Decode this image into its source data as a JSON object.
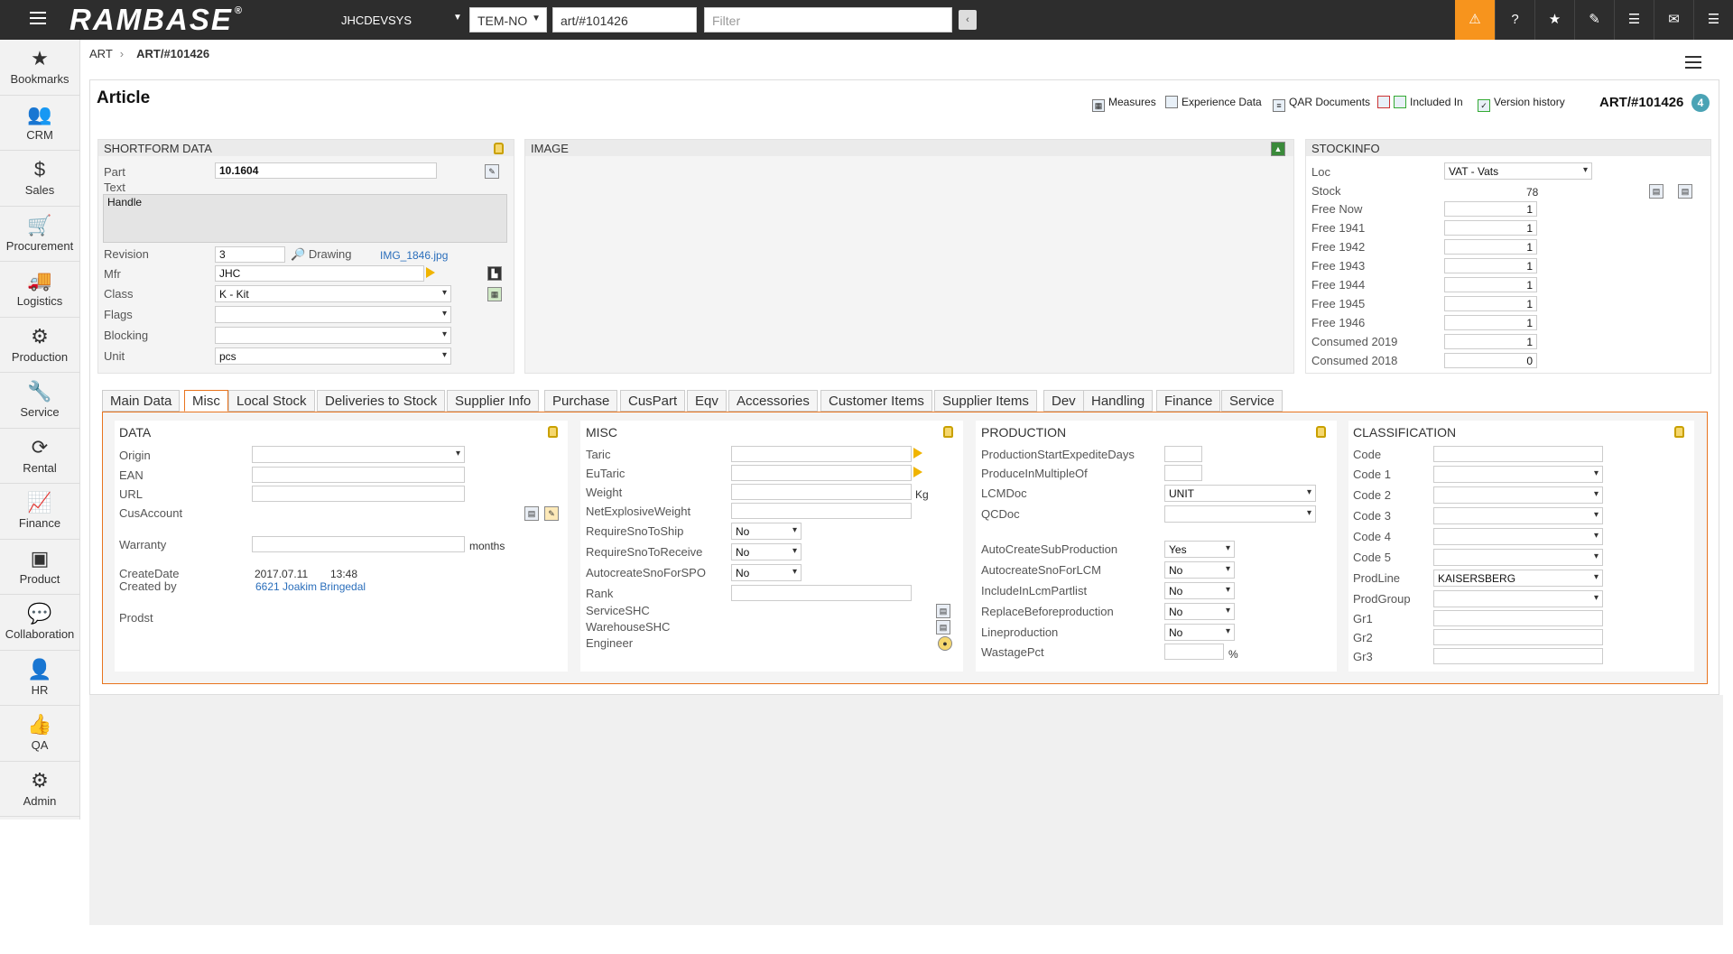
{
  "topbar": {
    "logo": "RAMBASE",
    "logo_mark": "®",
    "system": "JHCDEVSYS",
    "company": "TEM-NO",
    "location": "art/#101426",
    "filter_placeholder": "Filter",
    "collapse": "‹",
    "icons": [
      "warning-icon",
      "help-icon",
      "star-icon",
      "attachment-icon",
      "list-icon",
      "mail-icon",
      "menu-icon"
    ]
  },
  "sidebar": {
    "items": [
      {
        "label": "Bookmarks",
        "icon": "★"
      },
      {
        "label": "CRM",
        "icon": "👥"
      },
      {
        "label": "Sales",
        "icon": "$"
      },
      {
        "label": "Procurement",
        "icon": "🛒"
      },
      {
        "label": "Logistics",
        "icon": "🚚"
      },
      {
        "label": "Production",
        "icon": "⚙"
      },
      {
        "label": "Service",
        "icon": "🔧"
      },
      {
        "label": "Rental",
        "icon": "⟳"
      },
      {
        "label": "Finance",
        "icon": "📈"
      },
      {
        "label": "Product",
        "icon": "▣"
      },
      {
        "label": "Collaboration",
        "icon": "💬"
      },
      {
        "label": "HR",
        "icon": "👤"
      },
      {
        "label": "QA",
        "icon": "👍"
      },
      {
        "label": "Admin",
        "icon": "⚙"
      }
    ]
  },
  "breadcrumb": {
    "root": "ART",
    "sep": "›",
    "current": "ART/#101426"
  },
  "article": {
    "title": "Article",
    "links": {
      "measures": "Measures",
      "experience": "Experience Data",
      "qar": "QAR Documents",
      "included": "Included In",
      "version": "Version history"
    },
    "number": "ART/#101426",
    "badge": "4"
  },
  "shortform": {
    "header": "SHORTFORM DATA",
    "part_label": "Part",
    "part": "10.1604",
    "text_label": "Text",
    "text": "Handle",
    "revision_label": "Revision",
    "revision": "3",
    "drawing_label": "Drawing",
    "drawing": "IMG_1846.jpg",
    "mfr_label": "Mfr",
    "mfr": "JHC",
    "class_label": "Class",
    "class": "K - Kit",
    "flags_label": "Flags",
    "flags": "",
    "blocking_label": "Blocking",
    "blocking": "",
    "unit_label": "Unit",
    "unit": "pcs"
  },
  "image": {
    "header": "IMAGE"
  },
  "stockinfo": {
    "header": "STOCKINFO",
    "loc_label": "Loc",
    "loc": "VAT - Vats",
    "stock_label": "Stock",
    "stock": "78",
    "rows": [
      {
        "label": "Free Now",
        "value": "1"
      },
      {
        "label": "Free 1941",
        "value": "1"
      },
      {
        "label": "Free 1942",
        "value": "1"
      },
      {
        "label": "Free 1943",
        "value": "1"
      },
      {
        "label": "Free 1944",
        "value": "1"
      },
      {
        "label": "Free 1945",
        "value": "1"
      },
      {
        "label": "Free 1946",
        "value": "1"
      },
      {
        "label": "Consumed 2019",
        "value": "1"
      },
      {
        "label": "Consumed 2018",
        "value": "0"
      }
    ]
  },
  "tabs": [
    "Main Data",
    "Misc",
    "Local Stock",
    "Deliveries to Stock",
    "Supplier Info",
    "Purchase",
    "CusPart",
    "Eqv",
    "Accessories",
    "Customer Items",
    "Supplier Items",
    "Dev",
    "Handling",
    "Finance",
    "Service"
  ],
  "data_panel": {
    "header": "DATA",
    "origin_label": "Origin",
    "origin": "",
    "ean_label": "EAN",
    "url_label": "URL",
    "cusaccount_label": "CusAccount",
    "warranty_label": "Warranty",
    "warranty_unit": "months",
    "createdate_label": "CreateDate",
    "createdate": "2017.07.11",
    "createtime": "13:48",
    "createdby_label": "Created by",
    "createdby": "6621 Joakim Bringedal",
    "prodst_label": "Prodst"
  },
  "misc_panel": {
    "header": "MISC",
    "taric": "Taric",
    "eutaric": "EuTaric",
    "weight": "Weight",
    "weight_unit": "Kg",
    "net": "NetExplosiveWeight",
    "req_ship_label": "RequireSnoToShip",
    "req_ship": "No",
    "req_recv_label": "RequireSnoToReceive",
    "req_recv": "No",
    "auto_spo_label": "AutocreateSnoForSPO",
    "auto_spo": "No",
    "rank": "Rank",
    "service": "ServiceSHC",
    "warehouse": "WarehouseSHC",
    "engineer": "Engineer"
  },
  "production_panel": {
    "header": "PRODUCTION",
    "start": "ProductionStartExpediteDays",
    "multiple": "ProduceInMultipleOf",
    "lcm_label": "LCMDoc",
    "lcm": "UNIT",
    "qc_label": "QCDoc",
    "qc": "",
    "auto_sub_label": "AutoCreateSubProduction",
    "auto_sub": "Yes",
    "auto_lcm_label": "AutocreateSnoForLCM",
    "auto_lcm": "No",
    "include_label": "IncludeInLcmPartlist",
    "include": "No",
    "replace_label": "ReplaceBeforeproduction",
    "replace": "No",
    "line_label": "Lineproduction",
    "line": "No",
    "wastage": "WastagePct",
    "wastage_unit": "%"
  },
  "classification_panel": {
    "header": "CLASSIFICATION",
    "code": "Code",
    "code1": "Code 1",
    "code2": "Code 2",
    "code3": "Code 3",
    "code4": "Code 4",
    "code5": "Code 5",
    "prodline_label": "ProdLine",
    "prodline": "KAISERSBERG",
    "prodgroup": "ProdGroup",
    "gr1": "Gr1",
    "gr2": "Gr2",
    "gr3": "Gr3"
  },
  "colors": {
    "accent": "#f7941d",
    "topbar": "#2d2d2d",
    "tab_border": "#e8741e",
    "link": "#2a6ebb"
  }
}
